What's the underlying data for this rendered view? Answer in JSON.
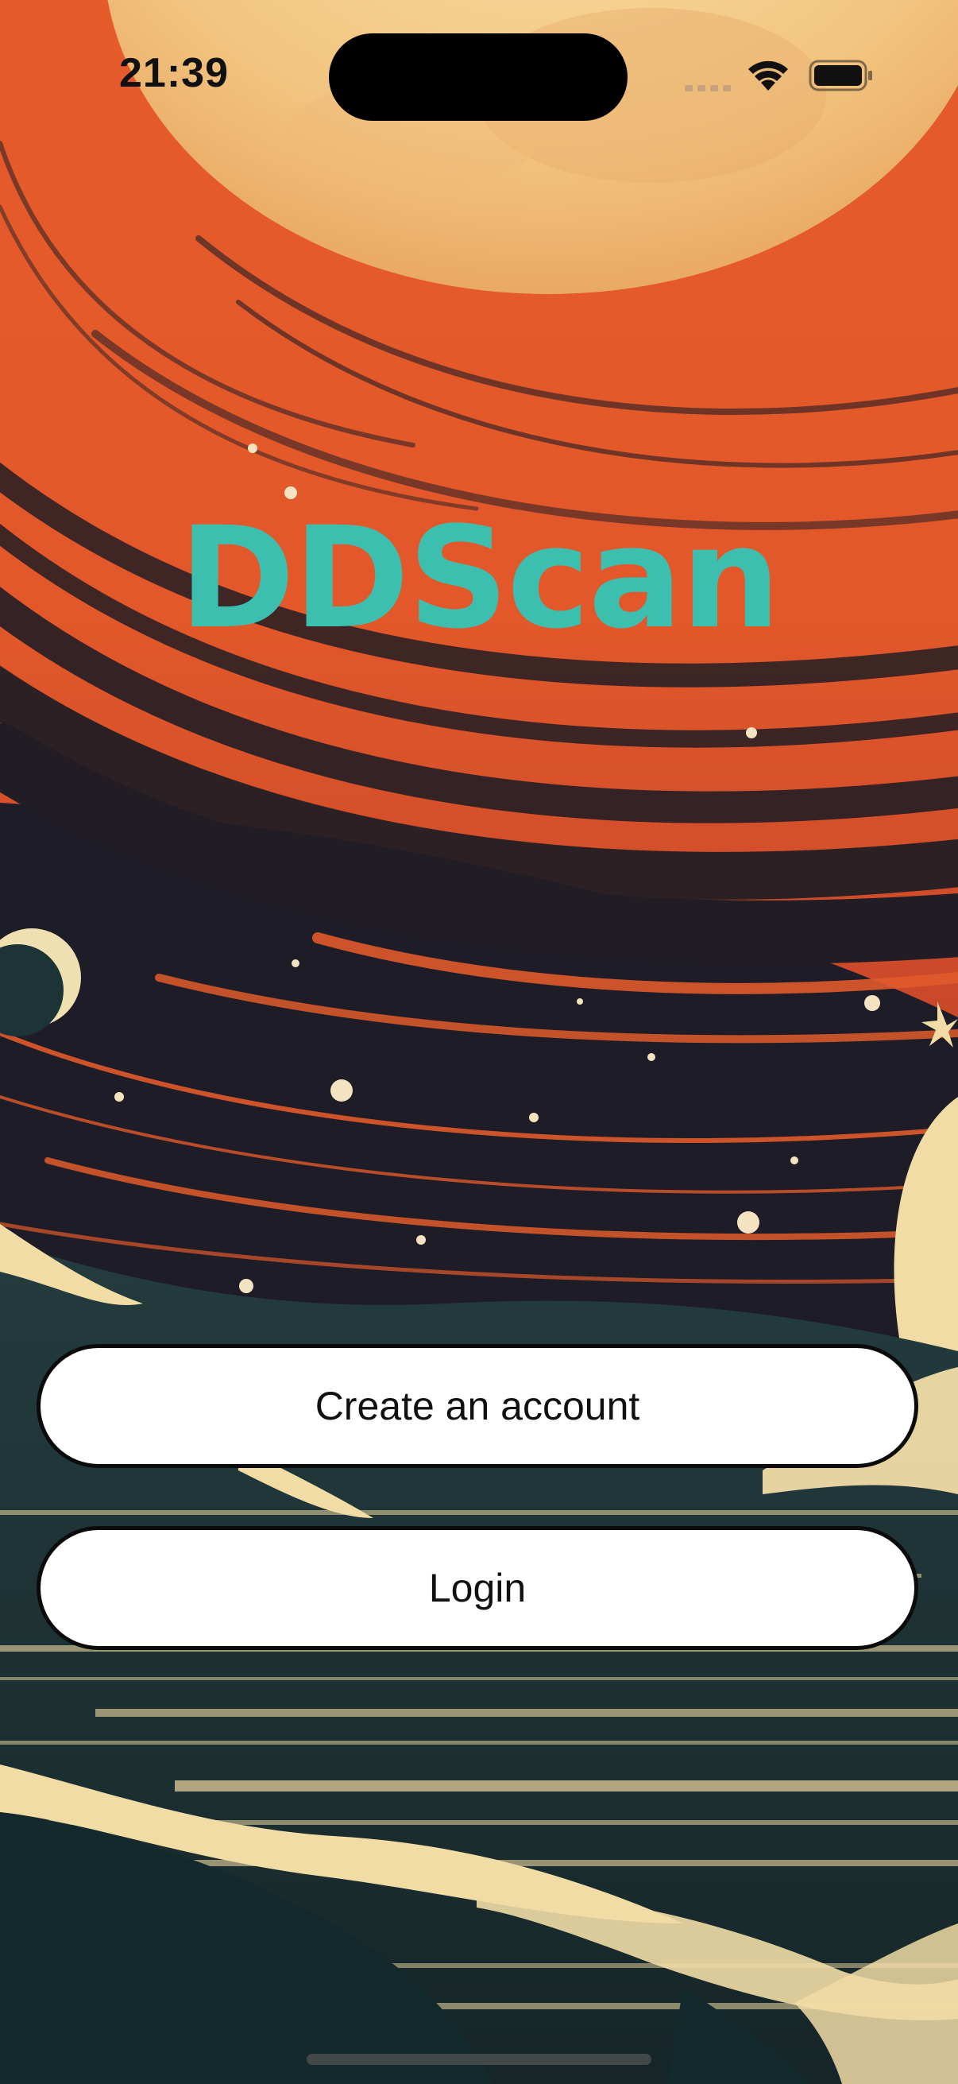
{
  "status_bar": {
    "time": "21:39",
    "icons": [
      "cellular-signal-icon",
      "wifi-icon",
      "battery-icon"
    ]
  },
  "app": {
    "title": "DDScan",
    "title_color": "#3dbfb0"
  },
  "actions": {
    "create_account_label": "Create an account",
    "login_label": "Login"
  },
  "colors": {
    "sky_orange": "#e05a2c",
    "moon_cream": "#f6cf8e",
    "space_dark": "#1e1c26",
    "sea_teal": "#1f3a3c",
    "wave_cream": "#f1dca6"
  }
}
